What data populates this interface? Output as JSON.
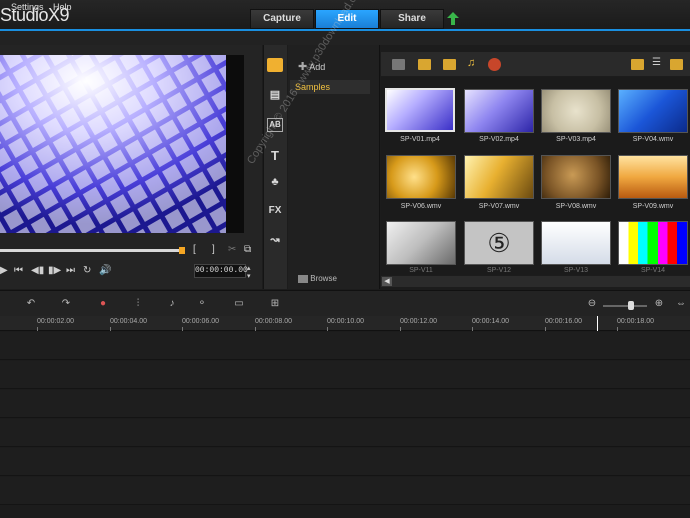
{
  "app": {
    "title": "StudioX9"
  },
  "tabs": [
    {
      "label": "Capture",
      "active": false
    },
    {
      "label": "Edit",
      "active": true
    },
    {
      "label": "Share",
      "active": false
    }
  ],
  "menu": {
    "settings": "Settings",
    "help": "Help"
  },
  "preview": {
    "timecode": "00:00:00.00"
  },
  "library": {
    "add_label": "Add",
    "folder_label": "Samples",
    "browse_label": "Browse",
    "thumbnails": [
      {
        "caption": "SP-V01.mp4",
        "selected": true
      },
      {
        "caption": "SP-V02.mp4",
        "selected": false
      },
      {
        "caption": "SP-V03.mp4",
        "selected": false
      },
      {
        "caption": "SP-V04.wmv",
        "selected": false
      },
      {
        "caption": "SP-V06.wmv",
        "selected": false
      },
      {
        "caption": "SP-V07.wmv",
        "selected": false
      },
      {
        "caption": "SP-V08.wmv",
        "selected": false
      },
      {
        "caption": "SP-V09.wmv",
        "selected": false
      },
      {
        "caption": "SP-V11",
        "selected": false
      },
      {
        "caption": "SP-V12",
        "selected": false
      },
      {
        "caption": "SP-V13",
        "selected": false
      },
      {
        "caption": "SP-V14",
        "selected": false
      }
    ]
  },
  "timeline": {
    "ruler_labels": [
      "00:00:02.00",
      "00:00:04.00",
      "00:00:06.00",
      "00:00:08.00",
      "00:00:10.00",
      "00:00:12.00",
      "00:00:14.00",
      "00:00:16.00",
      "00:00:18.00"
    ]
  },
  "watermark": "Copyright © 2016 - www.p30download.com",
  "colors": {
    "accent": "#1a8fe0",
    "folder_text": "#f0c040",
    "scrub_handle": "#f5a623"
  }
}
